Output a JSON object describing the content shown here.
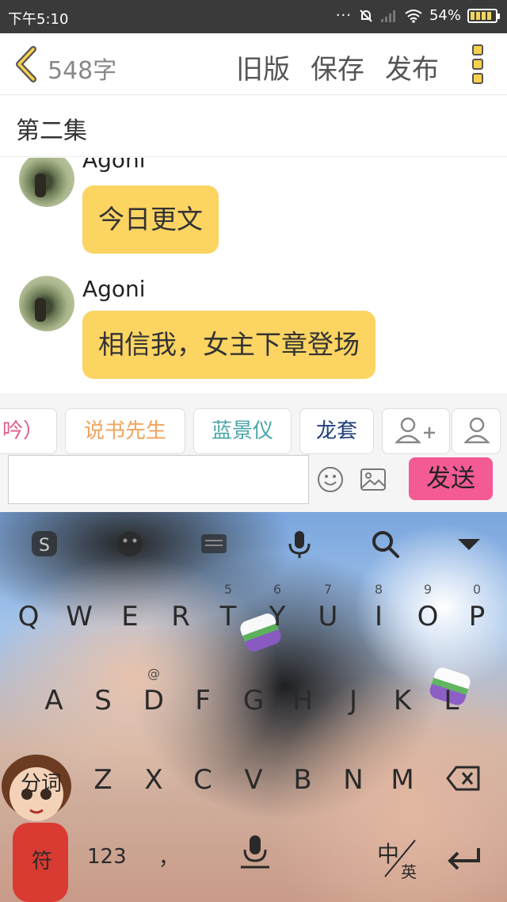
{
  "status_bar": {
    "time": "下午5:10",
    "dots": "···",
    "battery": "54%"
  },
  "toolbar": {
    "word_count": "548字",
    "old_version_label": "旧版",
    "save_label": "保存",
    "publish_label": "发布"
  },
  "chapter": {
    "title": "第二集"
  },
  "messages": [
    {
      "sender": "Agoni",
      "text": "今日更文"
    },
    {
      "sender": "Agoni",
      "text": "相信我，女主下章登场"
    }
  ],
  "roles": [
    {
      "label": "吟）",
      "color": "#e05c8a"
    },
    {
      "label": "说书先生",
      "color": "#f3a35c"
    },
    {
      "label": "蓝景仪",
      "color": "#4aa6a8"
    },
    {
      "label": "龙套",
      "color": "#1e3d7a"
    }
  ],
  "input": {
    "value": "",
    "send_label": "发送"
  },
  "keyboard": {
    "row1": [
      {
        "key": "Q",
        "hint": ""
      },
      {
        "key": "W",
        "hint": ""
      },
      {
        "key": "E",
        "hint": ""
      },
      {
        "key": "R",
        "hint": ""
      },
      {
        "key": "T",
        "hint": "5"
      },
      {
        "key": "Y",
        "hint": "6"
      },
      {
        "key": "U",
        "hint": "7"
      },
      {
        "key": "I",
        "hint": "8"
      },
      {
        "key": "O",
        "hint": "9"
      },
      {
        "key": "P",
        "hint": "0"
      }
    ],
    "row2": [
      {
        "key": "A",
        "hint": ""
      },
      {
        "key": "S",
        "hint": ""
      },
      {
        "key": "D",
        "hint": "@"
      },
      {
        "key": "F",
        "hint": ""
      },
      {
        "key": "G",
        "hint": ""
      },
      {
        "key": "H",
        "hint": ""
      },
      {
        "key": "J",
        "hint": ""
      },
      {
        "key": "K",
        "hint": ""
      },
      {
        "key": "L",
        "hint": ""
      }
    ],
    "row3": [
      {
        "key": "Z",
        "hint": ""
      },
      {
        "key": "X",
        "hint": ""
      },
      {
        "key": "C",
        "hint": ""
      },
      {
        "key": "V",
        "hint": ""
      },
      {
        "key": "B",
        "hint": ""
      },
      {
        "key": "N",
        "hint": ""
      },
      {
        "key": "M",
        "hint": ""
      }
    ],
    "split_word_label": "分词",
    "symbol_label": "符",
    "number_label": "123",
    "comma_label": "，",
    "lang_primary": "中",
    "lang_secondary": "英"
  },
  "colors": {
    "accent_yellow": "#fcd462",
    "send_pink": "#f45b94"
  }
}
